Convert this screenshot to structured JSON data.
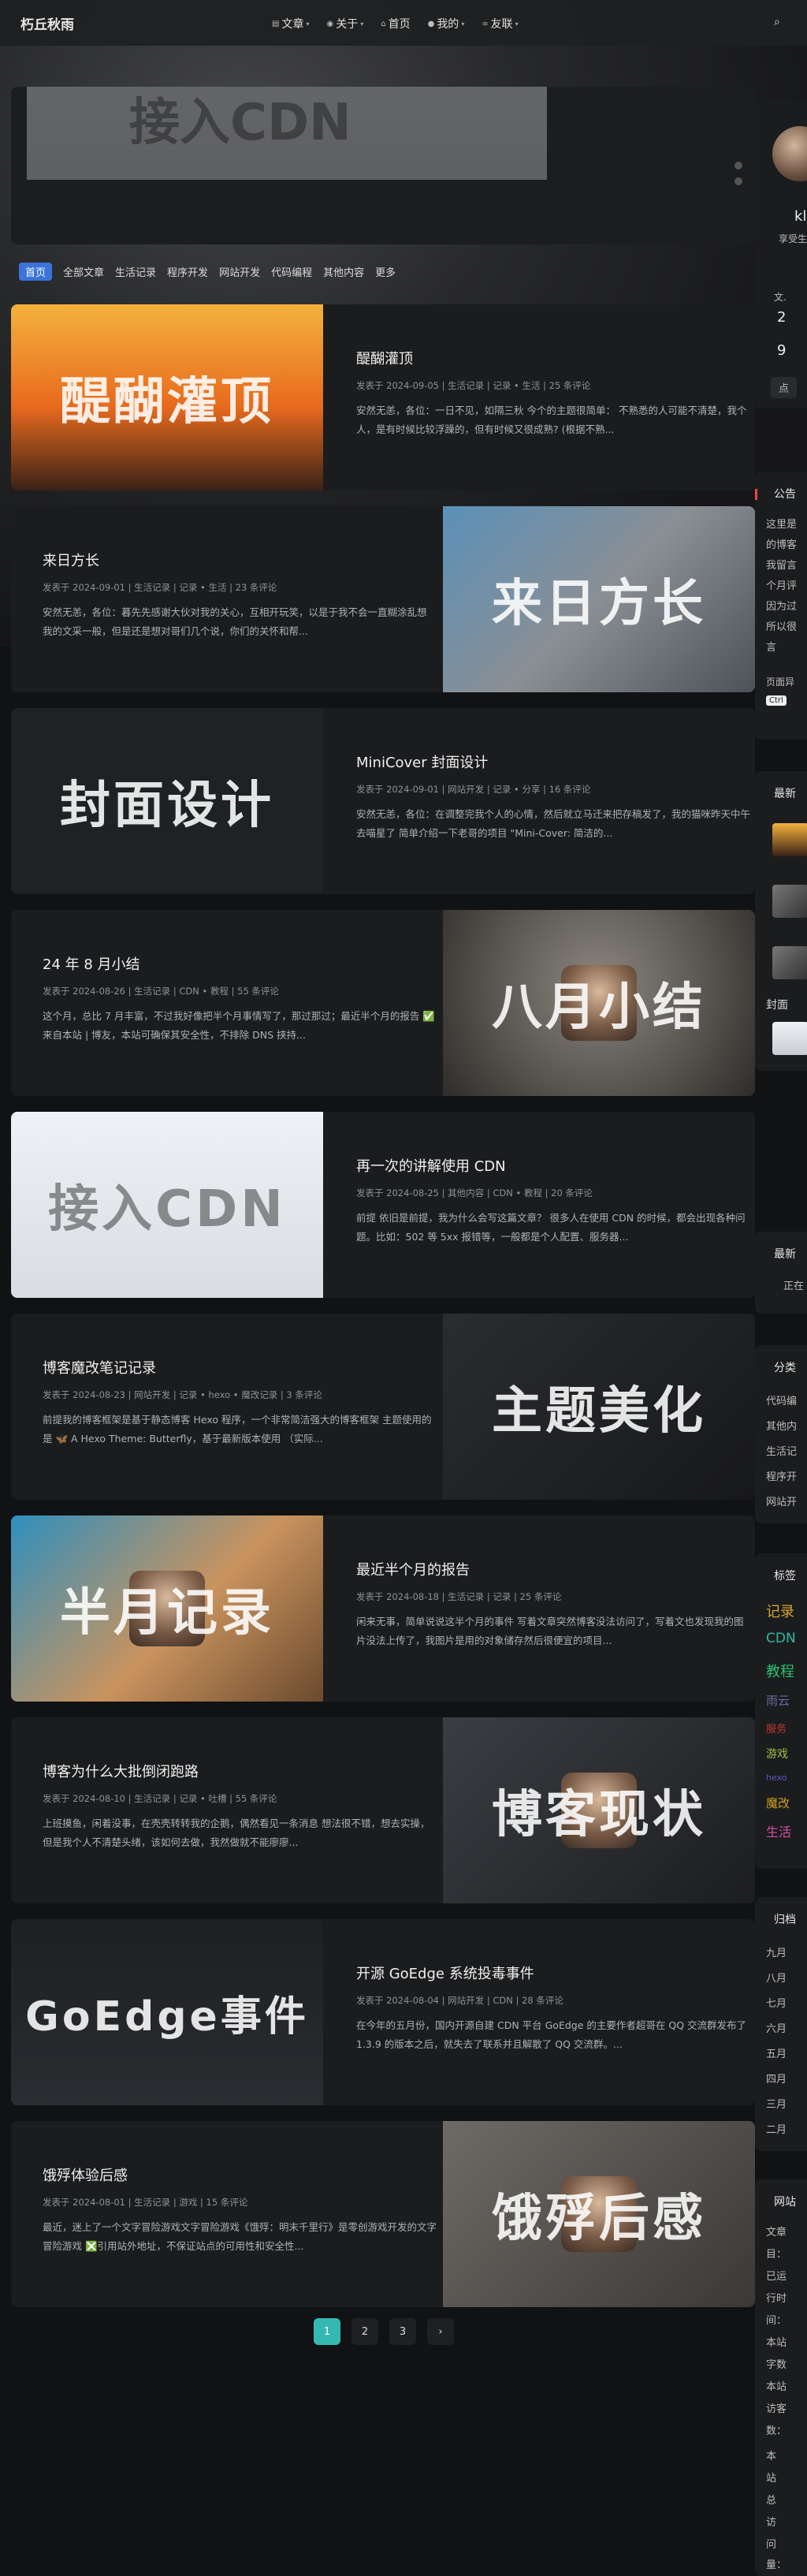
{
  "site": {
    "title": "朽丘秋雨"
  },
  "nav": {
    "items": [
      {
        "label": "文章",
        "icon": "archive-icon",
        "dropdown": true
      },
      {
        "label": "关于",
        "icon": "info-icon",
        "dropdown": true
      },
      {
        "label": "首页",
        "icon": "home-icon",
        "dropdown": false
      },
      {
        "label": "我的",
        "icon": "user-icon",
        "dropdown": true
      },
      {
        "label": "友联",
        "icon": "link-icon",
        "dropdown": true
      }
    ]
  },
  "banner": {
    "text": "接入CDN"
  },
  "categories": [
    "首页",
    "全部文章",
    "生活记录",
    "程序开发",
    "网站开发",
    "代码编程",
    "其他内容",
    "更多"
  ],
  "posts": [
    {
      "title": "醍醐灌顶",
      "cover_text": "醍醐灌顶",
      "meta": "发表于 2024-09-05 | 生活记录 | 记录 • 生活 | 25 条评论",
      "excerpt": "安然无恙，各位：一日不见，如隔三秋 今个的主题很简单： 不熟悉的人可能不清楚，我个人，是有时候比较浮躁的，但有时候又很成熟? (根据不熟...",
      "side": "left"
    },
    {
      "title": "来日方长",
      "cover_text": "来日方长",
      "meta": "发表于 2024-09-01 | 生活记录 | 记录 • 生活 | 23 条评论",
      "excerpt": "安然无恙，各位：暮先先感谢大伙对我的关心，互相开玩笑，以是于我不会一直糊涂乱想 我的文采一般，但是还是想对哥们几个说，你们的关怀和帮...",
      "side": "right"
    },
    {
      "title": "MiniCover 封面设计",
      "cover_text": "封面设计",
      "meta": "发表于 2024-09-01 | 网站开发 | 记录 • 分享 | 16 条评论",
      "excerpt": "安然无恙，各位：在调整完我个人的心情，然后就立马迁来把存稿发了，我的猫咪昨天中午去喵星了 简单介绍一下老哥的项目 \"Mini-Cover: 简洁的...",
      "side": "left"
    },
    {
      "title": "24 年 8 月小结",
      "cover_text": "八月小结",
      "meta": "发表于 2024-08-26 | 生活记录 | CDN • 教程 | 55 条评论",
      "excerpt": "这个月，总比 7 月丰富，不过我好像把半个月事情写了，那过那过；最近半个月的报告 ✅来自本站 | 博友，本站可确保其安全性，不排除 DNS 挟持...",
      "side": "right"
    },
    {
      "title": "再一次的讲解使用 CDN",
      "cover_text": "接入CDN",
      "meta": "发表于 2024-08-25 | 其他内容 | CDN • 教程 | 20 条评论",
      "excerpt": "前提 依旧是前提，我为什么会写这篇文章？ 很多人在使用 CDN 的时候，都会出现各种问题。比如：502 等 5xx 报错等，一般都是个人配置、服务器...",
      "side": "left"
    },
    {
      "title": "博客魔改笔记记录",
      "cover_text": "主题美化",
      "meta": "发表于 2024-08-23 | 网站开发 | 记录 • hexo • 魔改记录 | 3 条评论",
      "excerpt": "前提我的博客框架是基于静态博客 Hexo 程序，一个非常简洁强大的博客框架 主题使用的是 🦋 A Hexo Theme: Butterfly，基于最新版本使用 （实际...",
      "side": "right"
    },
    {
      "title": "最近半个月的报告",
      "cover_text": "半月记录",
      "meta": "发表于 2024-08-18 | 生活记录 | 记录 | 25 条评论",
      "excerpt": "闲来无事，简单说说这半个月的事件 写着文章突然博客没法访问了，写着文也发现我的图片没法上传了，我图片是用的对象储存然后很便宜的项目...",
      "side": "left"
    },
    {
      "title": "博客为什么大批倒闭跑路",
      "cover_text": "博客现状",
      "meta": "发表于 2024-08-10 | 生活记录 | 记录 • 吐槽 | 55 条评论",
      "excerpt": "上班摸鱼，闲着没事，在壳壳转转我的企鹅，偶然看见一条消息 想法很不错，想去实操，但是我个人不清楚头绪，该如何去做，我然做就不能廖廖...",
      "side": "right"
    },
    {
      "title": "开源 GoEdge 系统投毒事件",
      "cover_text": "GoEdge事件",
      "meta": "发表于 2024-08-04 | 网站开发 | CDN | 28 条评论",
      "excerpt": "在今年的五月份，国内开源自建 CDN 平台 GoEdge 的主要作者超哥在 QQ 交流群发布了 1.3.9 的版本之后，就失去了联系并且解散了 QQ 交流群。...",
      "side": "left"
    },
    {
      "title": "饿殍体验后感",
      "cover_text": "饿殍后感",
      "meta": "发表于 2024-08-01 | 生活记录 | 游戏 | 15 条评论",
      "excerpt": "最近，迷上了一个文字冒险游戏文字冒险游戏《饿殍：明末千里行》是零创游戏开发的文字冒险游戏 ❎引用站外地址，不保证站点的可用性和安全性...",
      "side": "right"
    }
  ],
  "pagination": {
    "pages": [
      "1",
      "2",
      "3"
    ],
    "current": "1",
    "next": "›"
  },
  "sidebar": {
    "profile_name": "kl",
    "profile_sub": "享受生",
    "stats": [
      "文.",
      "2",
      "9"
    ],
    "follow_btn": "点",
    "announce_title": "公告",
    "announce_lines": [
      "这里是",
      "的博客",
      "我留言",
      "个月评",
      "因为过",
      "所以很",
      "言"
    ],
    "announce_footer": "页面异",
    "ctrl_key": "Ctrl",
    "recent_title": "最新",
    "cover_title": "封面",
    "latest_comment_title": "最新",
    "latest_comment_text": "正在",
    "category_title": "分类",
    "category_items": [
      "代码编",
      "其他内",
      "生活记",
      "程序开",
      "网站开"
    ],
    "tags_title": "标签",
    "tags": [
      {
        "text": "记录",
        "color": "#d9a531"
      },
      {
        "text": "CDN",
        "color": "#30b8a6"
      },
      {
        "text": "教程",
        "color": "#2fbf71"
      },
      {
        "text": "雨云",
        "color": "#6a6aa8"
      },
      {
        "text": "服务",
        "color": "#c0392b"
      },
      {
        "text": "游戏",
        "color": "#a0c040"
      },
      {
        "text": "hexo",
        "color": "#5a5ac8"
      },
      {
        "text": "魔改",
        "color": "#d0a020"
      },
      {
        "text": "生活",
        "color": "#d44fa8"
      }
    ],
    "archive_title": "归档",
    "archive_items": [
      "九月",
      "八月",
      "七月",
      "六月",
      "五月",
      "四月",
      "三月",
      "二月"
    ],
    "siteinfo_title": "网站",
    "siteinfo_items": [
      "文章",
      "目：",
      "已运",
      "行时",
      "间：",
      "本站",
      "字数",
      "本站",
      "访客",
      "数：",
      "本",
      "站",
      "总",
      "访",
      "问",
      "量："
    ]
  }
}
